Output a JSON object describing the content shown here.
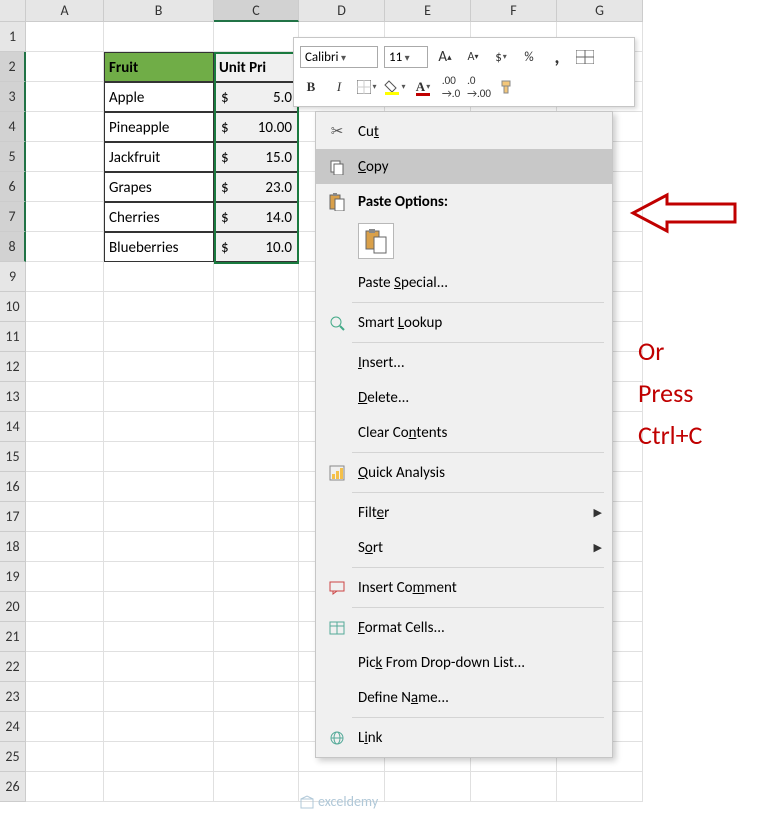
{
  "columns": [
    "A",
    "B",
    "C",
    "D",
    "E",
    "F",
    "G"
  ],
  "rowCount": 26,
  "selectedCol": "C",
  "selectedRows": [
    2,
    3,
    4,
    5,
    6,
    7,
    8
  ],
  "table": {
    "headers": {
      "fruit": "Fruit",
      "price": "Unit Pri"
    },
    "rows": [
      {
        "fruit": "Apple",
        "cur": "$",
        "price": "5.0"
      },
      {
        "fruit": "Pineapple",
        "cur": "$",
        "price": "10.00"
      },
      {
        "fruit": "Jackfruit",
        "cur": "$",
        "price": "15.0"
      },
      {
        "fruit": "Grapes",
        "cur": "$",
        "price": "23.0"
      },
      {
        "fruit": "Cherries",
        "cur": "$",
        "price": "14.0"
      },
      {
        "fruit": "Blueberries",
        "cur": "$",
        "price": "10.0"
      }
    ]
  },
  "miniToolbar": {
    "font": "Calibri",
    "size": "11",
    "currency": "$",
    "percent": "%",
    "comma": ","
  },
  "contextMenu": {
    "cut": "Cut",
    "copy": "Copy",
    "pasteOptions": "Paste Options:",
    "pasteSpecial": "Paste Special...",
    "smartLookup": "Smart Lookup",
    "insert": "Insert...",
    "delete": "Delete...",
    "clearContents": "Clear Contents",
    "quickAnalysis": "Quick Analysis",
    "filter": "Filter",
    "sort": "Sort",
    "insertComment": "Insert Comment",
    "formatCells": "Format Cells...",
    "pickFromList": "Pick From Drop-down List...",
    "defineName": "Define Name...",
    "link": "Link"
  },
  "annotation": {
    "line1": "Or",
    "line2": "Press",
    "line3": "Ctrl+C"
  },
  "watermark": "exceldemy"
}
